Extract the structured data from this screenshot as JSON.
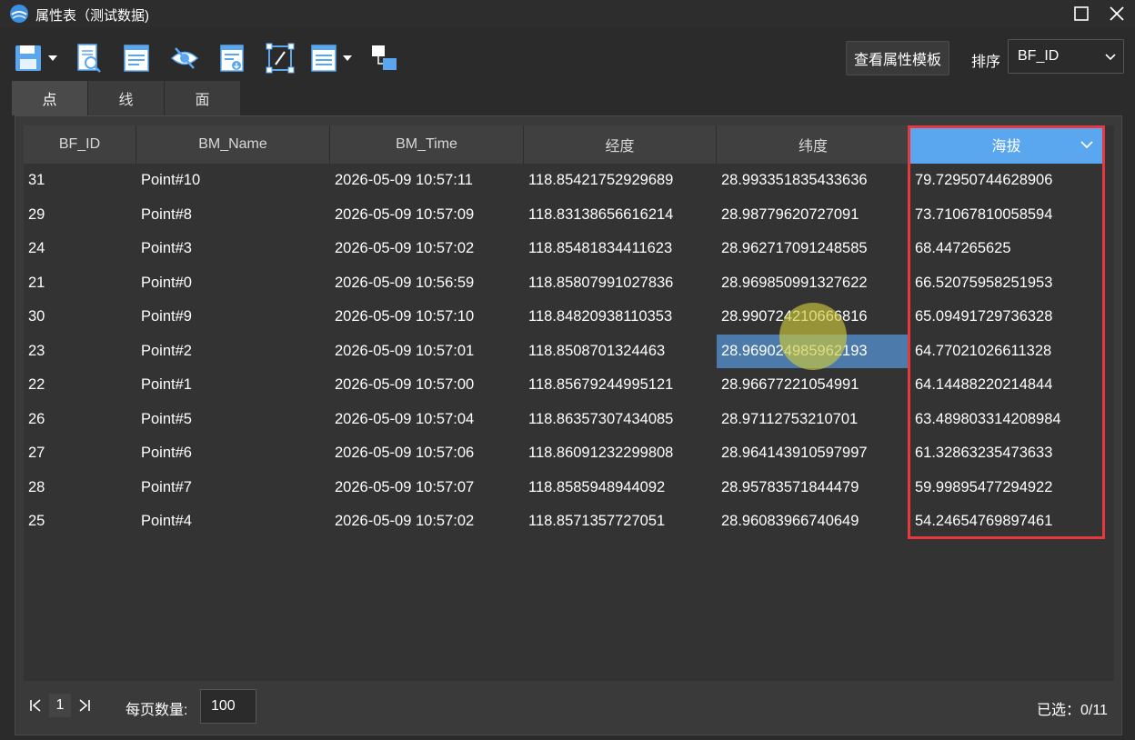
{
  "window": {
    "title": "属性表（测试数据)"
  },
  "toolbar": {
    "icons": [
      "save-icon",
      "search-document-icon",
      "list-view-icon",
      "hide-visibility-icon",
      "export-icon",
      "edit-geometry-icon",
      "table-options-icon",
      "relationship-icon"
    ],
    "template_button": "查看属性模板",
    "sort_label": "排序",
    "sort_value": "BF_ID"
  },
  "tabs": [
    "点",
    "线",
    "面"
  ],
  "table": {
    "columns": [
      "BF_ID",
      "BM_Name",
      "BM_Time",
      "经度",
      "纬度",
      "海拔"
    ],
    "rows": [
      [
        "31",
        "Point#10",
        "2026-05-09 10:57:11",
        "118.85421752929689",
        "28.993351835433636",
        "79.72950744628906"
      ],
      [
        "29",
        "Point#8",
        "2026-05-09 10:57:09",
        "118.83138656616214",
        "28.98779620727091",
        "73.71067810058594"
      ],
      [
        "24",
        "Point#3",
        "2026-05-09 10:57:02",
        "118.85481834411623",
        "28.962717091248585",
        "68.447265625"
      ],
      [
        "21",
        "Point#0",
        "2026-05-09 10:56:59",
        "118.85807991027836",
        "28.969850991327622",
        "66.52075958251953"
      ],
      [
        "30",
        "Point#9",
        "2026-05-09 10:57:10",
        "118.84820938110353",
        "28.990724210666816",
        "65.09491729736328"
      ],
      [
        "23",
        "Point#2",
        "2026-05-09 10:57:01",
        "118.8508701324463",
        "28.969024985962193",
        "64.77021026611328"
      ],
      [
        "22",
        "Point#1",
        "2026-05-09 10:57:00",
        "118.85679244995121",
        "28.96677221054991",
        "64.14488220214844"
      ],
      [
        "26",
        "Point#5",
        "2026-05-09 10:57:04",
        "118.86357307434085",
        "28.97112753210701",
        "63.489803314208984"
      ],
      [
        "27",
        "Point#6",
        "2026-05-09 10:57:06",
        "118.86091232299808",
        "28.964143910597997",
        "61.32863235473633"
      ],
      [
        "28",
        "Point#7",
        "2026-05-09 10:57:07",
        "118.8585948944092",
        "28.95783571844479",
        "59.99895477294922"
      ],
      [
        "25",
        "Point#4",
        "2026-05-09 10:57:02",
        "118.8571357727051",
        "28.96083966740649",
        "54.24654769897461"
      ]
    ]
  },
  "footer": {
    "page": "1",
    "per_page_label": "每页数量:",
    "per_page_value": "100",
    "selected": "已选：0/11"
  },
  "colors": {
    "selected_header": "#5aa7ef",
    "highlighted_cell": "#4c7bab",
    "annotation_box": "#e8383d"
  }
}
